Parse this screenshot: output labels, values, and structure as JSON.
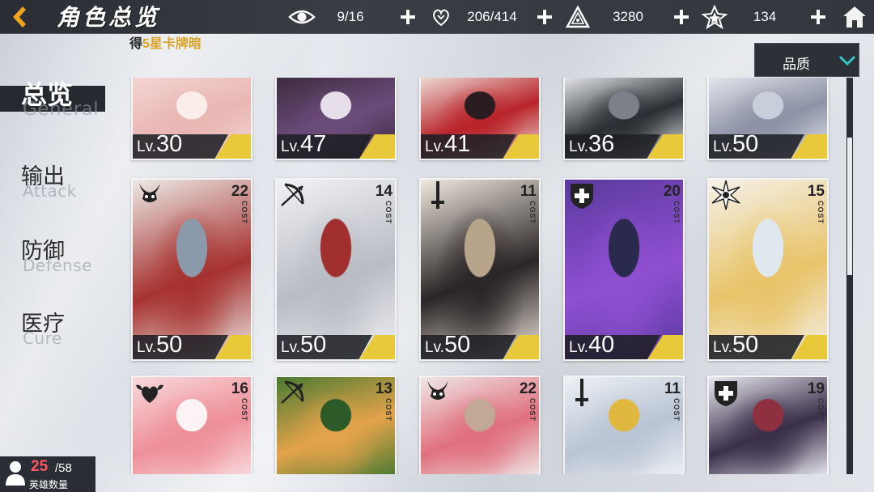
{
  "header": {
    "title": "角色总览",
    "resources": [
      {
        "icon": "eye-icon",
        "value": "9/16"
      },
      {
        "icon": "heart-hand-icon",
        "value": "206/414"
      },
      {
        "icon": "triangle-crest-icon",
        "value": "3280"
      },
      {
        "icon": "star-shard-icon",
        "value": "134"
      }
    ]
  },
  "ticker": {
    "prefix": "得",
    "highlight": "5星卡牌暗"
  },
  "filter": {
    "label": "品质"
  },
  "nav": [
    {
      "zh": "总览",
      "en": "General",
      "active": true
    },
    {
      "zh": "输出",
      "en": "Attack"
    },
    {
      "zh": "防御",
      "en": "Defense"
    },
    {
      "zh": "医疗",
      "en": "Cure"
    }
  ],
  "cost_label": "COST",
  "level_prefix": "Lv.",
  "cards": [
    {
      "level": "30",
      "cost": "",
      "class_icon": "",
      "palette": [
        "#f3d6d3",
        "#e9b7b4",
        "#fbeeea"
      ]
    },
    {
      "level": "47",
      "cost": "",
      "class_icon": "",
      "palette": [
        "#3a2a3a",
        "#6b4b7a",
        "#e6dfea"
      ]
    },
    {
      "level": "41",
      "cost": "",
      "class_icon": "",
      "palette": [
        "#f1e6df",
        "#b8242a",
        "#2a1b1e"
      ]
    },
    {
      "level": "36",
      "cost": "",
      "class_icon": "",
      "palette": [
        "#eef0f2",
        "#2b2e33",
        "#7d8088"
      ]
    },
    {
      "level": "50",
      "cost": "",
      "class_icon": "",
      "palette": [
        "#e8eaf0",
        "#8d93a6",
        "#c9cedb"
      ]
    },
    {
      "level": "50",
      "cost": "22",
      "class_icon": "demon-horn-icon",
      "palette": [
        "#eceae6",
        "#a63230",
        "#8a9aaa"
      ]
    },
    {
      "level": "50",
      "cost": "14",
      "class_icon": "bow-icon",
      "palette": [
        "#f1f2f4",
        "#b9bcc4",
        "#a02f2e"
      ]
    },
    {
      "level": "50",
      "cost": "11",
      "class_icon": "sword-icon",
      "palette": [
        "#efe8de",
        "#2a2526",
        "#b8a48a"
      ]
    },
    {
      "level": "40",
      "cost": "20",
      "class_icon": "shield-icon",
      "palette": [
        "#5a3a9e",
        "#8f4fd1",
        "#2a2a4e"
      ]
    },
    {
      "level": "50",
      "cost": "15",
      "class_icon": "star-burst-icon",
      "palette": [
        "#f5f1ea",
        "#e8c46a",
        "#dfe7ef"
      ]
    },
    {
      "level": "",
      "cost": "16",
      "class_icon": "heart-wings-icon",
      "palette": [
        "#f8d9dc",
        "#ee8f98",
        "#fbf3f4"
      ]
    },
    {
      "level": "",
      "cost": "13",
      "class_icon": "bow-icon",
      "palette": [
        "#4a7a32",
        "#e3a34a",
        "#2c5a28"
      ]
    },
    {
      "level": "",
      "cost": "22",
      "class_icon": "demon-horn-icon",
      "palette": [
        "#efe7e6",
        "#e0707e",
        "#c2a896"
      ]
    },
    {
      "level": "",
      "cost": "11",
      "class_icon": "sword-icon",
      "palette": [
        "#eef1f5",
        "#b9c4d4",
        "#e0b840"
      ]
    },
    {
      "level": "",
      "cost": "19",
      "class_icon": "shield-icon",
      "palette": [
        "#e9e8ef",
        "#3a2f4a",
        "#8f3040"
      ]
    }
  ],
  "hero_count": {
    "current": "25",
    "max": "/58",
    "label": "英雄数量"
  }
}
